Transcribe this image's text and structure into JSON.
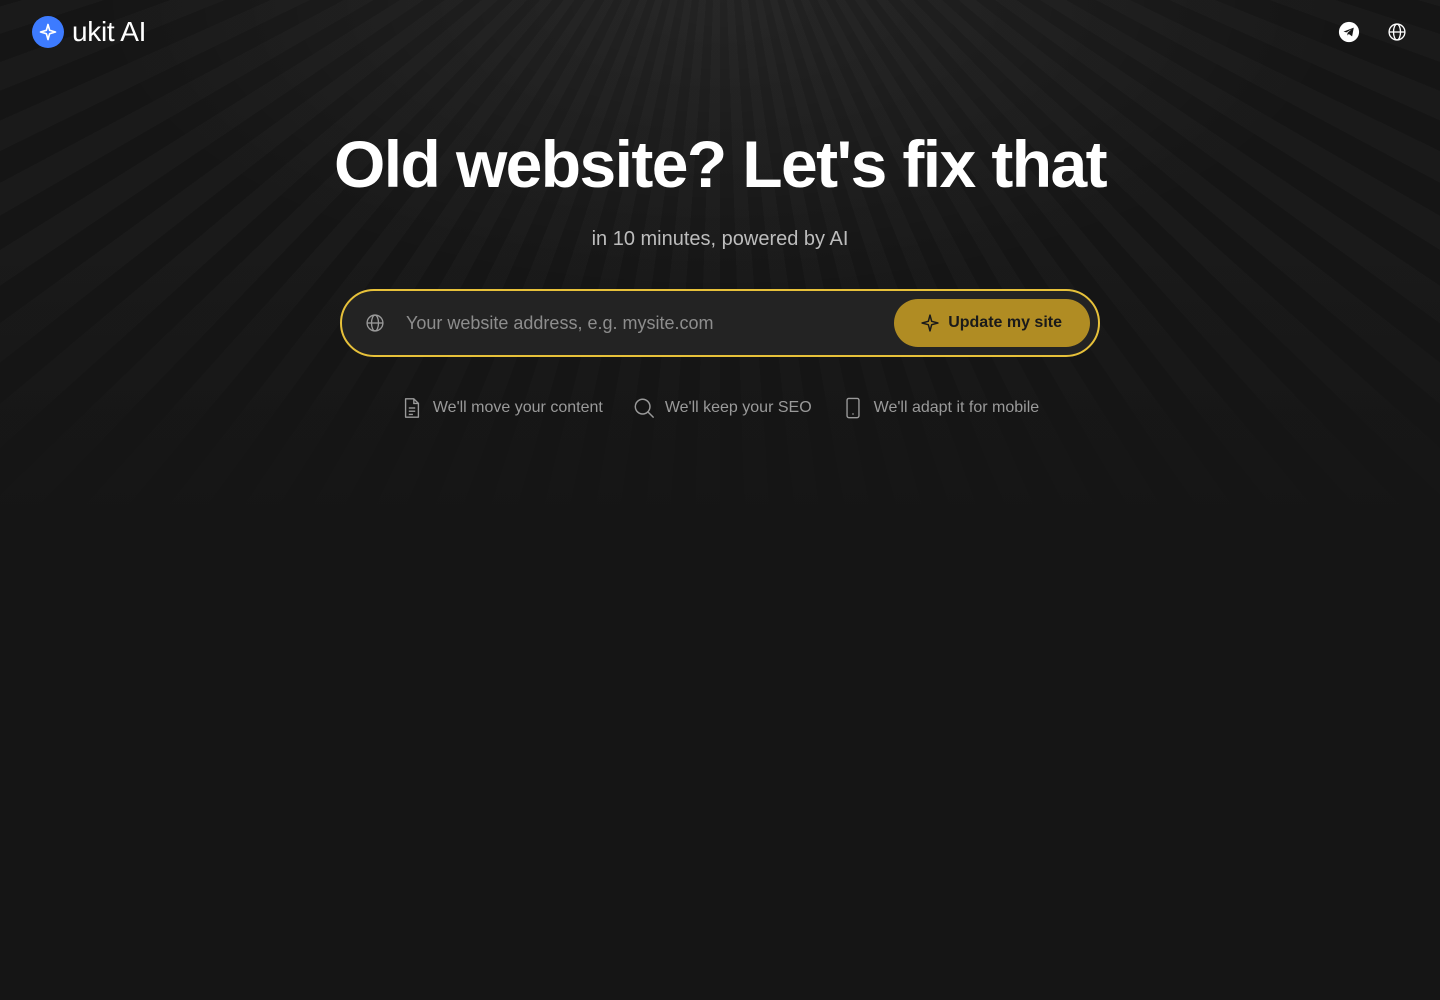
{
  "header": {
    "logo_text": "ukit AI",
    "logo_icon": "sparkle-icon",
    "brand_color": "#3d7bff",
    "actions": [
      {
        "name": "telegram-icon"
      },
      {
        "name": "globe-icon"
      }
    ]
  },
  "hero": {
    "title": "Old website? Let's fix that",
    "subtitle": "in 10 minutes, powered by AI"
  },
  "search": {
    "icon": "globe-icon",
    "placeholder": "Your website address, e.g. mysite.com",
    "value": "",
    "border_color": "#e7c13a",
    "button_label": "Update my site",
    "button_icon": "sparkle-icon",
    "button_color": "#b08c23"
  },
  "features": [
    {
      "icon": "document-icon",
      "label": "We'll move your content"
    },
    {
      "icon": "search-icon",
      "label": "We'll keep your SEO"
    },
    {
      "icon": "mobile-icon",
      "label": "We'll adapt it for mobile"
    }
  ]
}
